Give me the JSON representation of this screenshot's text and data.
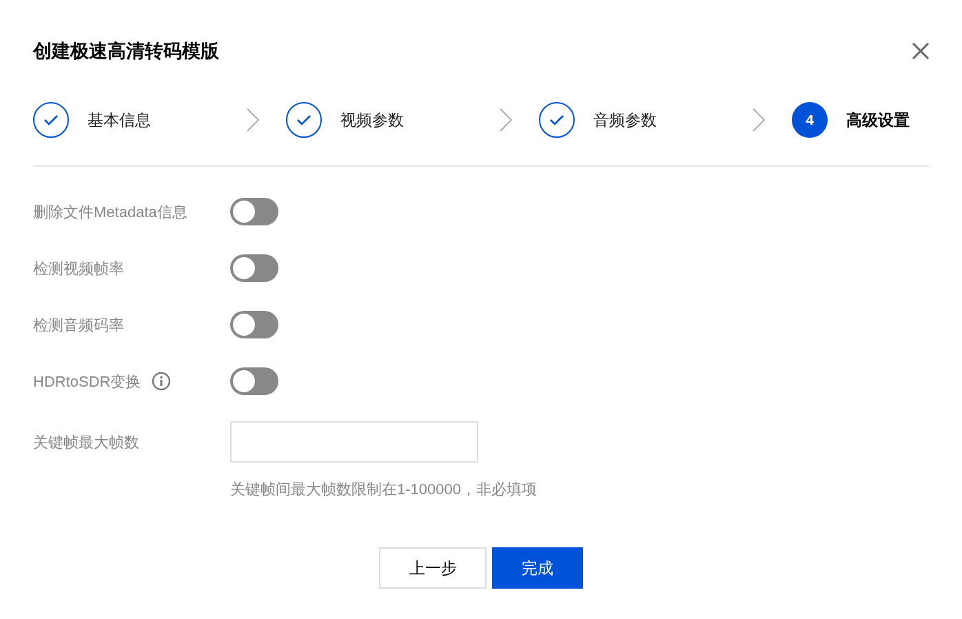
{
  "dialog": {
    "title": "创建极速高清转码模版"
  },
  "steps": [
    {
      "label": "基本信息",
      "kind": "done"
    },
    {
      "label": "视频参数",
      "kind": "done"
    },
    {
      "label": "音频参数",
      "kind": "done"
    },
    {
      "label": "高级设置",
      "kind": "current",
      "number": "4"
    }
  ],
  "toggles": [
    {
      "label": "删除文件Metadata信息",
      "on": false,
      "kind": "plain"
    },
    {
      "label": "检测视频帧率",
      "on": false,
      "kind": "plain"
    },
    {
      "label": "检测音频码率",
      "on": false,
      "kind": "plain"
    },
    {
      "label": "HDRtoSDR变换",
      "on": false,
      "kind": "info"
    }
  ],
  "keyframe_field": {
    "label": "关键帧最大帧数",
    "hint": "关键帧间最大帧数限制在1-100000，非必填项"
  },
  "buttons": [
    {
      "label": "上一步",
      "kind": "secondary"
    },
    {
      "label": "完成",
      "kind": "primary"
    }
  ]
}
